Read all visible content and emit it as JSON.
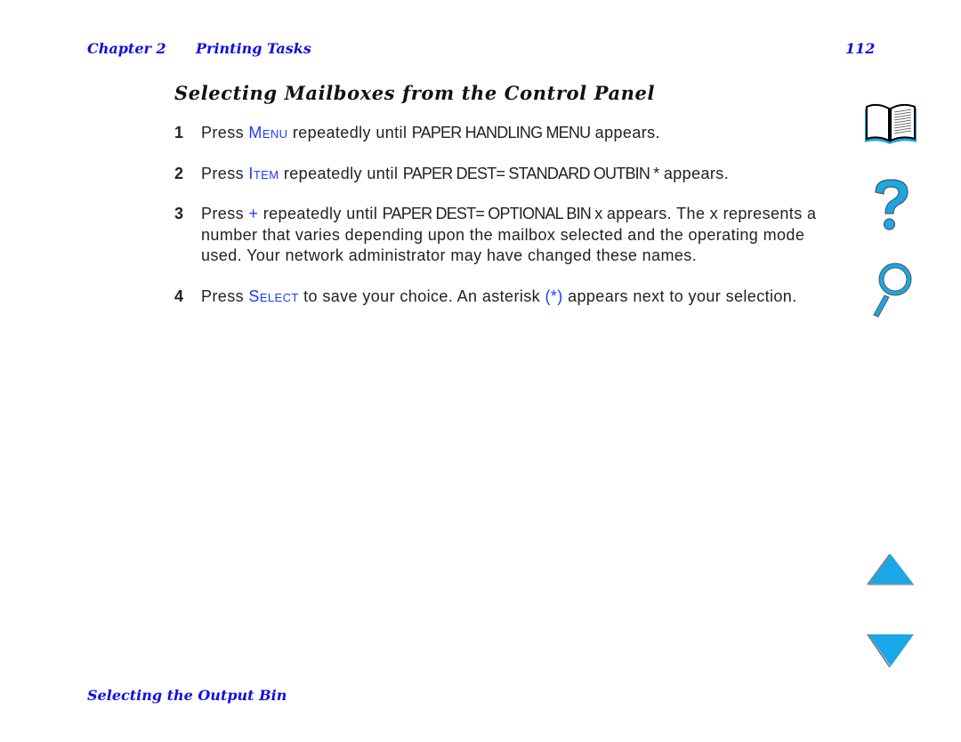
{
  "header": {
    "chapter": "Chapter 2",
    "chapter_title": "Printing Tasks",
    "page_number": "112"
  },
  "section_title": "Selecting Mailboxes from the Control Panel",
  "steps": [
    {
      "number": "1",
      "parts": [
        "Press ",
        "Menu",
        " repeatedly until ",
        "PAPER HANDLING MENU",
        " appears."
      ]
    },
    {
      "number": "2",
      "parts": [
        "Press ",
        "Item",
        " repeatedly until ",
        "PAPER DEST= STANDARD OUTBIN *",
        " appears."
      ]
    },
    {
      "number": "3",
      "parts": [
        "Press ",
        "+",
        " repeatedly until ",
        "PAPER DEST= OPTIONAL BIN x",
        " appears. The x represents a number that varies depending upon the mailbox selected and the operating mode used. Your network administrator may have changed these names."
      ]
    },
    {
      "number": "4",
      "parts": [
        "Press ",
        "Select",
        " to save your choice. An asterisk ",
        "(*)",
        " appears next to your selection."
      ]
    }
  ],
  "nav_icons": {
    "contents": "book-icon",
    "help": "question-mark-icon",
    "search": "magnifier-icon",
    "previous": "up-arrow-icon",
    "next": "down-arrow-icon"
  },
  "colors": {
    "link_blue": "#1010e0",
    "keyword_blue": "#1a3cff",
    "icon_blue": "#1aa7e8"
  },
  "footer": {
    "link": "Selecting the Output Bin"
  }
}
